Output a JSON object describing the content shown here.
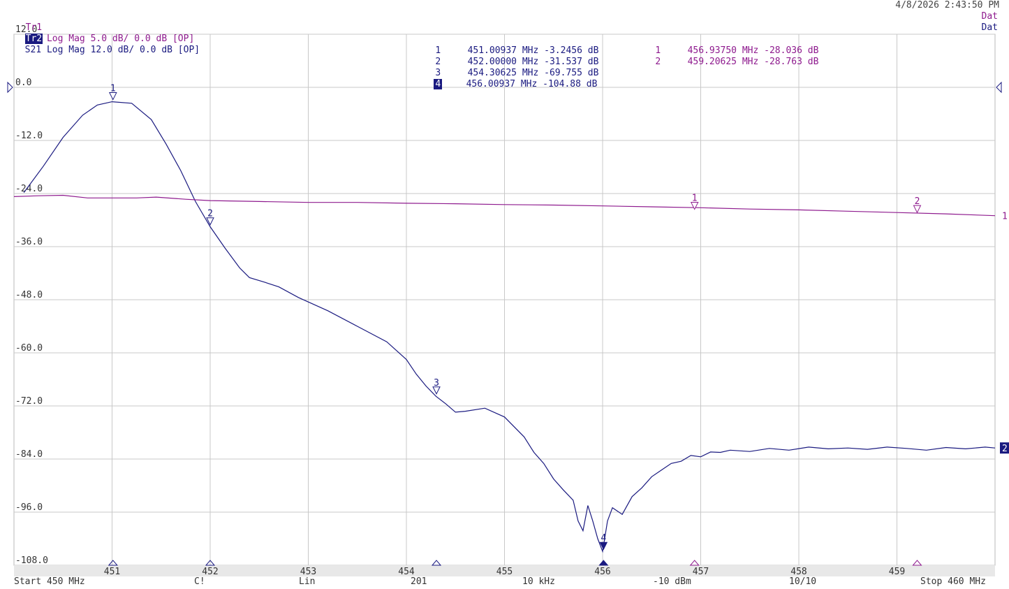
{
  "header": {
    "tr1": {
      "label": "Tr1",
      "text": "S11 Log Mag 5.0 dB/ 0.0 dB [OP]"
    },
    "tr2": {
      "label": "Tr2",
      "text": "S21 Log Mag 12.0 dB/ 0.0 dB [OP]"
    },
    "timestamp": "4/8/2026 2:43:50 PM",
    "dat1": "Dat",
    "dat2": "Dat"
  },
  "marker_table_tr2": [
    {
      "num": "1",
      "freq": "451.00937 MHz",
      "value": "-3.2456 dB"
    },
    {
      "num": "2",
      "freq": "452.00000 MHz",
      "value": "-31.537 dB"
    },
    {
      "num": "3",
      "freq": "454.30625 MHz",
      "value": "-69.755 dB"
    },
    {
      "num": "4",
      "freq": "456.00937 MHz",
      "value": "-104.88 dB"
    }
  ],
  "marker_table_tr1": [
    {
      "num": "1",
      "freq": "456.93750 MHz",
      "value": "-28.036 dB"
    },
    {
      "num": "2",
      "freq": "459.20625 MHz",
      "value": "-28.763 dB"
    }
  ],
  "footer": {
    "start": "Start 450 MHz",
    "cal": "C!",
    "sweep": "Lin",
    "points": "201",
    "ifbw": "10 kHz",
    "power": "-10 dBm",
    "avg": "10/10",
    "stop": "Stop 460 MHz"
  },
  "colors": {
    "tr1": "#8e1a8e",
    "tr2": "#1a1a80",
    "grid": "#c8c8c8"
  },
  "chart_data": {
    "type": "line",
    "x_range": [
      450,
      460
    ],
    "xticks": [
      "451",
      "452",
      "453",
      "454",
      "455",
      "456",
      "457",
      "458",
      "459"
    ],
    "y_range": [
      -108,
      12
    ],
    "yticks": [
      "12.0",
      "0.0",
      "-12.0",
      "-24.0",
      "-36.0",
      "-48.0",
      "-60.0",
      "-72.0",
      "-84.0",
      "-96.0",
      "-108.0"
    ],
    "reference_level": 0.0,
    "series": [
      {
        "name": "S21",
        "trace_label": "2",
        "color": "#1a1a80",
        "x": [
          450.1,
          450.3,
          450.5,
          450.7,
          450.85,
          451.0,
          451.2,
          451.4,
          451.55,
          451.7,
          451.85,
          452.0,
          452.15,
          452.3,
          452.4,
          452.55,
          452.7,
          452.9,
          453.2,
          453.5,
          453.8,
          454.0,
          454.1,
          454.2,
          454.3,
          454.4,
          454.5,
          454.6,
          454.8,
          455.0,
          455.2,
          455.3,
          455.4,
          455.5,
          455.6,
          455.7,
          455.75,
          455.8,
          455.85,
          455.9,
          455.95,
          456.0,
          456.05,
          456.1,
          456.2,
          456.3,
          456.4,
          456.5,
          456.6,
          456.7,
          456.8,
          456.9,
          457.0,
          457.1,
          457.2,
          457.3,
          457.5,
          457.7,
          457.9,
          458.1,
          458.3,
          458.5,
          458.7,
          458.9,
          459.1,
          459.3,
          459.5,
          459.7,
          459.9,
          460.0
        ],
        "y": [
          -23.8,
          -17.8,
          -11.3,
          -6.3,
          -4.0,
          -3.25,
          -3.6,
          -7.3,
          -12.8,
          -18.8,
          -25.8,
          -31.5,
          -36.3,
          -40.8,
          -43.0,
          -44.0,
          -45.1,
          -47.5,
          -50.5,
          -54.0,
          -57.5,
          -61.5,
          -64.8,
          -67.5,
          -69.8,
          -71.5,
          -73.4,
          -73.2,
          -72.5,
          -74.5,
          -79.0,
          -82.5,
          -85.0,
          -88.5,
          -91.0,
          -93.3,
          -98.0,
          -100.2,
          -94.5,
          -98.0,
          -102.0,
          -104.88,
          -98.0,
          -95.0,
          -96.5,
          -92.5,
          -90.5,
          -88.0,
          -86.5,
          -85.0,
          -84.5,
          -83.2,
          -83.5,
          -82.4,
          -82.5,
          -82.0,
          -82.3,
          -81.6,
          -82.0,
          -81.3,
          -81.7,
          -81.5,
          -81.8,
          -81.3,
          -81.6,
          -82.0,
          -81.4,
          -81.7,
          -81.3,
          -81.5
        ],
        "markers": [
          {
            "num": "1",
            "x": 451.00937,
            "y": -3.2456
          },
          {
            "num": "2",
            "x": 452.0,
            "y": -31.537
          },
          {
            "num": "3",
            "x": 454.30625,
            "y": -69.755
          },
          {
            "num": "4",
            "x": 456.00937,
            "y": -104.88,
            "active": true
          }
        ]
      },
      {
        "name": "S11",
        "trace_label": "1",
        "color": "#8e1a8e",
        "x": [
          450.0,
          450.25,
          450.5,
          450.75,
          451.0,
          451.25,
          451.45,
          451.75,
          452.0,
          452.5,
          453.0,
          453.5,
          454.0,
          454.5,
          455.0,
          455.5,
          456.0,
          456.5,
          457.0,
          457.5,
          458.0,
          458.5,
          459.0,
          459.5,
          460.0
        ],
        "y": [
          -24.7,
          -24.5,
          -24.4,
          -25.0,
          -25.0,
          -25.0,
          -24.8,
          -25.3,
          -25.6,
          -25.8,
          -26.0,
          -26.0,
          -26.2,
          -26.3,
          -26.5,
          -26.6,
          -26.8,
          -27.0,
          -27.2,
          -27.5,
          -27.7,
          -28.0,
          -28.3,
          -28.6,
          -29.0
        ],
        "markers": [
          {
            "num": "1",
            "x": 456.9375,
            "y": -28.036
          },
          {
            "num": "2",
            "x": 459.20625,
            "y": -28.763
          }
        ]
      }
    ]
  }
}
